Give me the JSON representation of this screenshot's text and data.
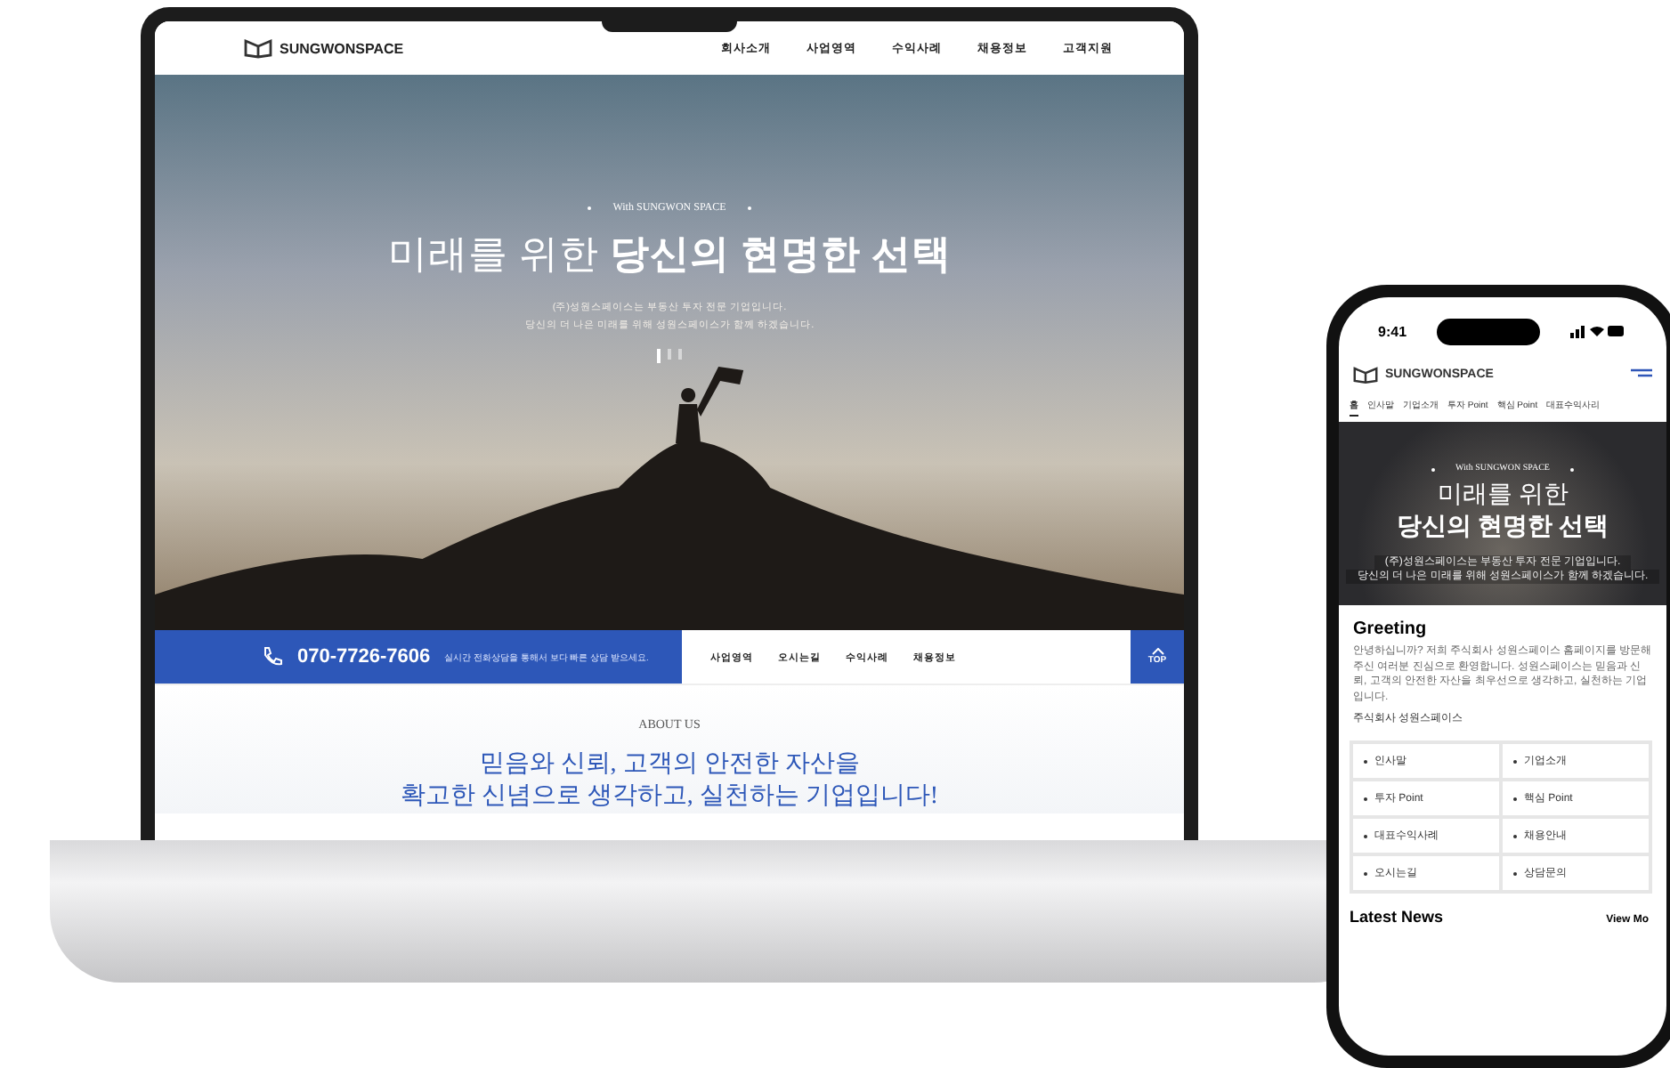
{
  "laptop": {
    "logo": "SUNGWONSPACE",
    "nav": [
      "회사소개",
      "사업영역",
      "수익사례",
      "채용정보",
      "고객지원"
    ],
    "hero": {
      "eyebrow": "With SUNGWON SPACE",
      "title": "미래를 위한 **당신의 현명한 선택**",
      "subtitle": [
        "(주)성원스페이스는 부동산 투자 전문 기업입니다.",
        "당신의 더 나은 미래를 위해 성원스페이스가 함께 하겠습니다."
      ],
      "slides": [
        {
          "selected": true
        },
        {
          "selected": false
        },
        {
          "selected": false
        }
      ]
    },
    "quick_bar": {
      "phone": "070-7726-7606",
      "note": "실시간 전화상담을 통해서 보다 빠른 상담 받으세요.",
      "links": [
        "사업영역",
        "오시는길",
        "수익사례",
        "채용정보"
      ],
      "top": "TOP"
    },
    "about": {
      "eyebrow": "ABOUT US",
      "heading": [
        "믿음와 신뢰, 고객의 안전한 자산을",
        "확고한 신념으로 생각하고, 실천하는 기업입니다!"
      ]
    }
  },
  "phone": {
    "time": "9:41",
    "logo": "SUNGWONSPACE",
    "tabs": [
      {
        "label": "홈",
        "selected": true
      },
      {
        "label": "인사말",
        "selected": false
      },
      {
        "label": "기업소개",
        "selected": false
      },
      {
        "label": "투자 Point",
        "selected": false
      },
      {
        "label": "핵심 Point",
        "selected": false
      },
      {
        "label": "대표수익사리",
        "selected": false
      }
    ],
    "hero": {
      "eyebrow": "With SUNGWON SPACE",
      "title": [
        "미래를 위한",
        "당신의 현명한 선택"
      ],
      "subtitle": [
        "(주)성원스페이스는 부동산 투자 전문 기업입니다.",
        "당신의 더 나은 미래를 위해 성원스페이스가 함께 하겠습니다."
      ]
    },
    "greeting": {
      "title": "Greeting",
      "body": "안녕하십니까? 저희 주식회사 성원스페이스 홈페이지를 방문해주신 여러분 진심으로 환영합니다. 성원스페이스는 믿음과 신뢰, 고객의 안전한 자산을 최우선으로 생각하고, 실천하는 기업입니다.",
      "signature": "주식회사 성원스페이스"
    },
    "links": [
      "인사말",
      "기업소개",
      "투자 Point",
      "핵심 Point",
      "대표수익사례",
      "채용안내",
      "오시는길",
      "상담문의"
    ],
    "news": {
      "title": "Latest News",
      "more": "View Mo"
    }
  }
}
